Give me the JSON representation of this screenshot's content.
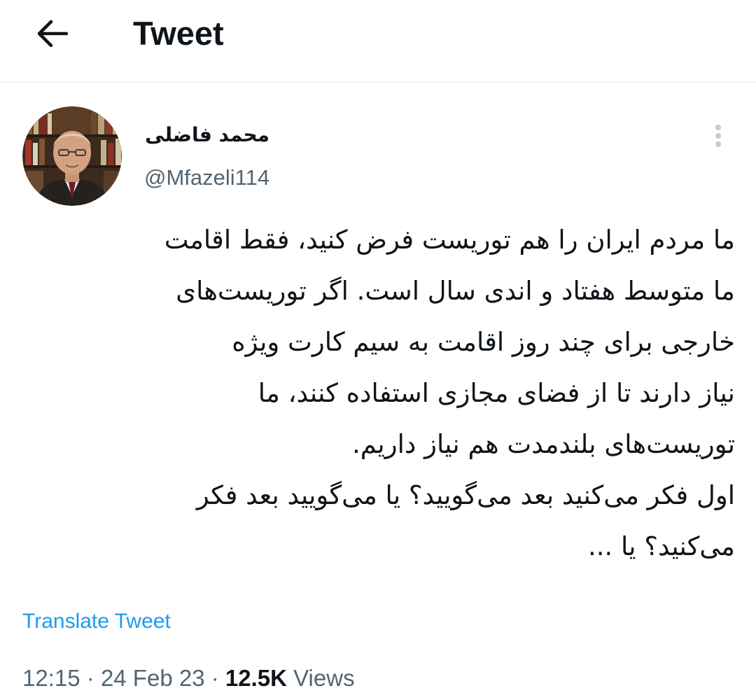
{
  "header": {
    "title": "Tweet",
    "back_icon": "arrow-left-icon"
  },
  "tweet": {
    "author": {
      "display_name": "محمد فاضلی",
      "handle": "@Mfazeli114",
      "avatar_icon": "avatar-photo"
    },
    "more_icon": "more-vertical-icon",
    "lines": [
      "ما مردم ایران را هم توریست فرض کنید، فقط اقامت",
      "ما متوسط هفتاد و اندی سال است. اگر توریست‌های",
      "خارجی برای چند روز اقامت به سیم کارت ویژه",
      "نیاز دارند تا از فضای مجازی استفاده کنند، ما",
      "توریست‌های بلندمدت هم نیاز داریم.",
      "اول فکر می‌کنید بعد می‌گویید؟ یا می‌گویید بعد فکر",
      "می‌کنید؟ یا ..."
    ],
    "translate_label": "Translate Tweet",
    "time": "12:15",
    "separator": "·",
    "date": "24 Feb 23",
    "views_count": "12.5K",
    "views_label": "Views"
  },
  "colors": {
    "text_primary": "#0f1419",
    "text_secondary": "#536471",
    "link": "#1d9bf0",
    "divider": "#e6ecf0"
  }
}
